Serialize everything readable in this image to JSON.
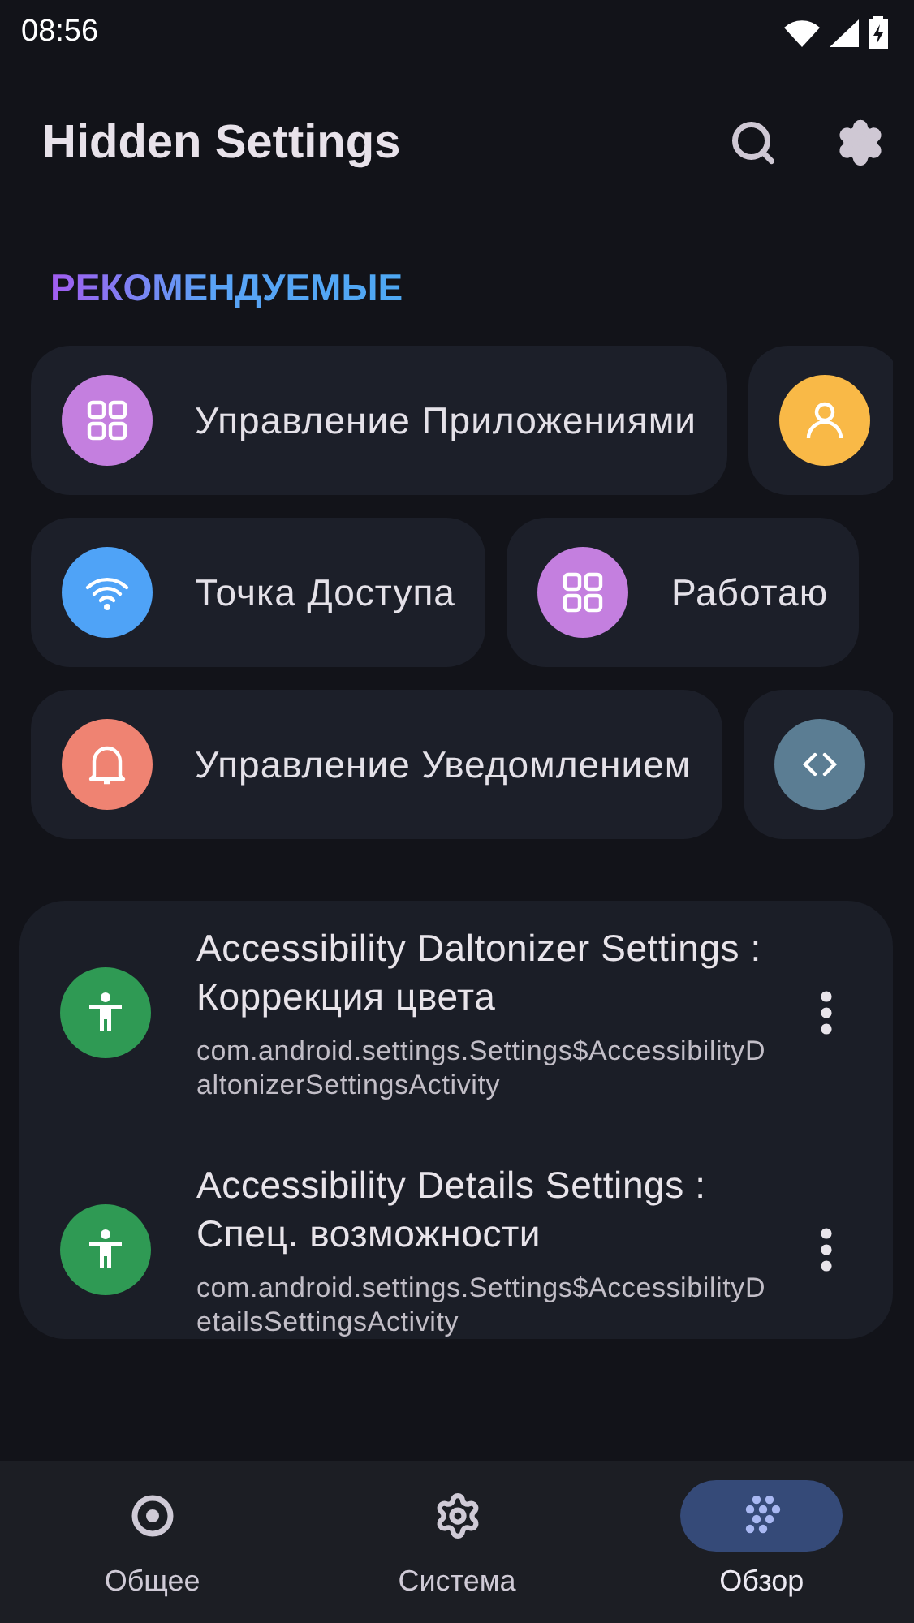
{
  "status_bar": {
    "time": "08:56"
  },
  "app_bar": {
    "title": "Hidden Settings"
  },
  "section": {
    "title": "РЕКОМЕНДУЕМЫЕ"
  },
  "chip_rows": [
    [
      {
        "label": "Управление Приложениями",
        "kind": "grid",
        "color": "#c47fdf"
      },
      {
        "kind": "person",
        "color": "#f9b947"
      }
    ],
    [
      {
        "label": "Точка Доступа",
        "kind": "wifi",
        "color": "#4fa3f7"
      },
      {
        "label": "Работаю",
        "kind": "grid",
        "color": "#c47fdf"
      }
    ],
    [
      {
        "label": "Управление Уведомлением",
        "kind": "bell",
        "color": "#ef8372"
      },
      {
        "kind": "code",
        "color": "#5b7d93"
      }
    ]
  ],
  "activities": [
    {
      "title": "Accessibility Daltonizer Settings : Коррекция цвета",
      "class_name": "com.android.settings.Settings$AccessibilityDaltonizerSettingsActivity"
    },
    {
      "title": "Accessibility Details Settings : Спец. возможности",
      "class_name": "com.android.settings.Settings$AccessibilityDetailsSettingsActivity"
    }
  ],
  "nav": [
    {
      "label": "Общее",
      "kind": "target",
      "selected": false
    },
    {
      "label": "Система",
      "kind": "gear",
      "selected": false
    },
    {
      "label": "Обзор",
      "kind": "dots",
      "selected": true
    }
  ]
}
